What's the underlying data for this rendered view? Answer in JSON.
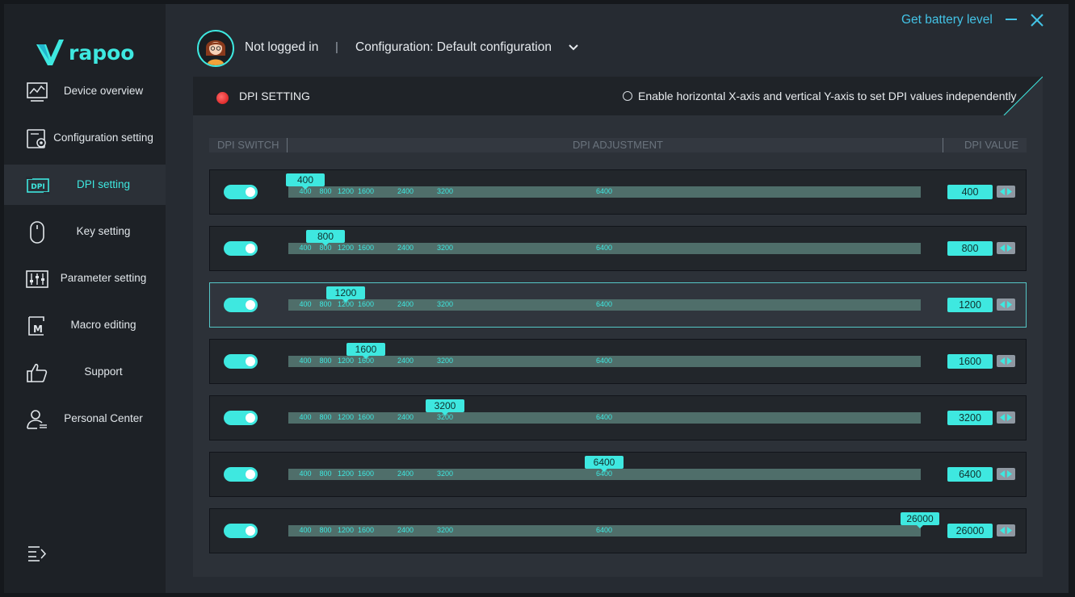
{
  "brand": {
    "logo_text": "rapoo"
  },
  "sidebar": {
    "items": [
      {
        "label": "Device overview",
        "icon": "chart-monitor-icon",
        "active": false
      },
      {
        "label": "Configuration setting",
        "icon": "config-gear-icon",
        "active": false
      },
      {
        "label": "DPI setting",
        "icon": "dpi-icon",
        "active": true
      },
      {
        "label": "Key setting",
        "icon": "mouse-icon",
        "active": false
      },
      {
        "label": "Parameter setting",
        "icon": "sliders-icon",
        "active": false
      },
      {
        "label": "Macro editing",
        "icon": "macro-icon",
        "active": false
      },
      {
        "label": "Support",
        "icon": "thumbs-up-icon",
        "active": false
      },
      {
        "label": "Personal Center",
        "icon": "person-icon",
        "active": false
      }
    ],
    "collapse_icon": "menu-collapse-icon"
  },
  "header": {
    "login_status": "Not logged in",
    "separator": "|",
    "configuration": "Configuration: Default configuration",
    "battery_link": "Get battery level"
  },
  "window": {
    "minimize_icon": "minimize-icon",
    "close_icon": "close-icon"
  },
  "panel": {
    "title": "DPI SETTING",
    "independent_xy_label": "Enable horizontal X-axis and vertical Y-axis to set DPI values independently",
    "independent_xy_checked": false,
    "columns": {
      "switch": "DPI SWITCH",
      "adjustment": "DPI ADJUSTMENT",
      "value": "DPI VALUE"
    },
    "slider_range": [
      100,
      26000
    ],
    "slider_ticks": [
      "400",
      "800",
      "1200",
      "1600",
      "2400",
      "3200",
      "6400"
    ],
    "rows": [
      {
        "enabled": true,
        "value": "400",
        "active": false
      },
      {
        "enabled": true,
        "value": "800",
        "active": false
      },
      {
        "enabled": true,
        "value": "1200",
        "active": true
      },
      {
        "enabled": true,
        "value": "1600",
        "active": false
      },
      {
        "enabled": true,
        "value": "3200",
        "active": false
      },
      {
        "enabled": true,
        "value": "6400",
        "active": false
      },
      {
        "enabled": true,
        "value": "26000",
        "active": false
      }
    ]
  },
  "colors": {
    "accent": "#3ee8e0",
    "link": "#43c3e6",
    "indicator": "#e02b2b"
  }
}
